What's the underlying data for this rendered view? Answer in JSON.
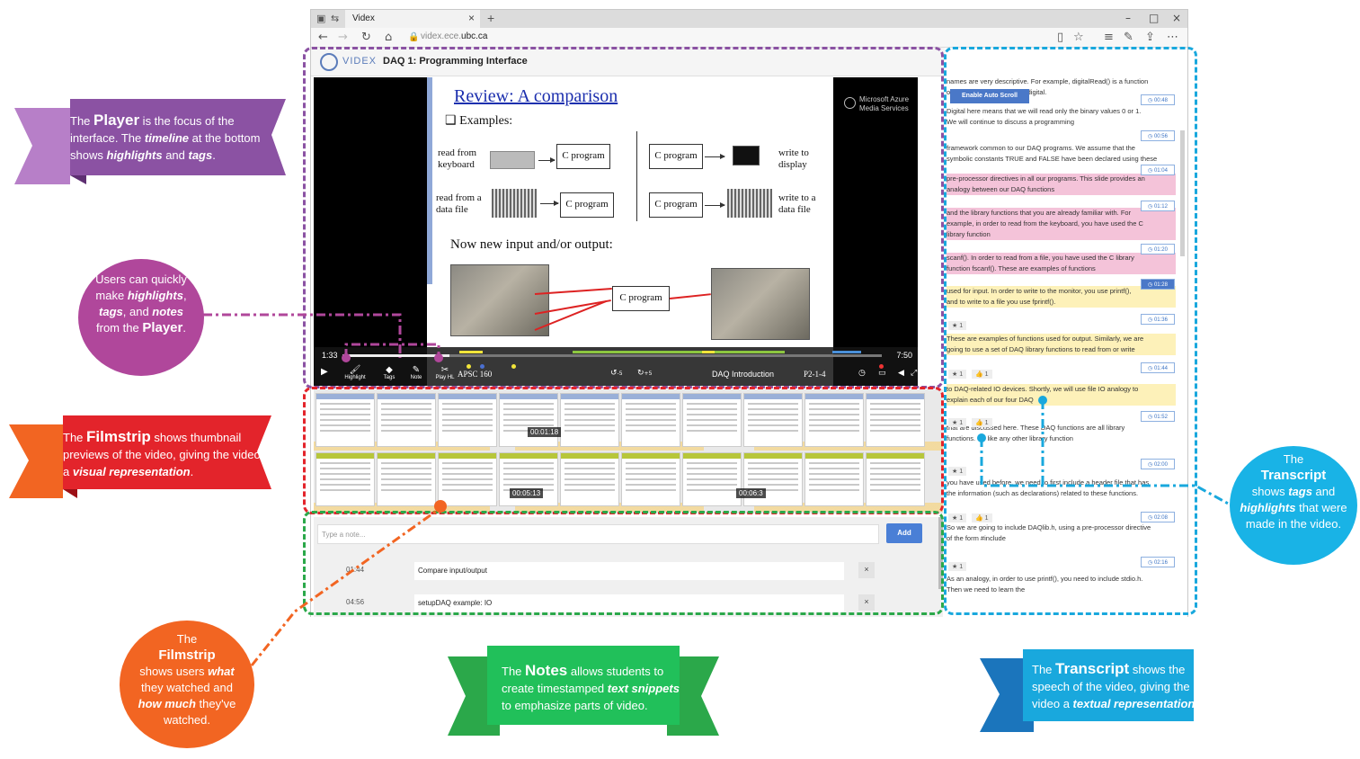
{
  "browser": {
    "tab_title": "Videx",
    "url_prefix": "videx.ece.",
    "url_domain": "ubc.ca"
  },
  "app": {
    "logo_text": "VIDEX",
    "lecture_title": "DAQ 1: Programming Interface"
  },
  "slide": {
    "title": "Review: A comparison",
    "subtitle": "Examples:",
    "read_keyboard": "read from keyboard",
    "read_datafile": "read from a data file",
    "c_program": "C program",
    "write_display": "write to display",
    "write_datafile": "write to a data file",
    "now_new": "Now new input and/or output:",
    "azure": "Microsoft Azure Media Services"
  },
  "player": {
    "current_time": "1:33",
    "total_time": "7:50",
    "progress_fraction": 0.198,
    "buttons": {
      "highlight": "Highlight",
      "tags": "Tags",
      "note": "Note",
      "play_hl": "Play HL"
    },
    "course": "APSC 160",
    "video_title": "DAQ Introduction",
    "video_code": "P2-1-4",
    "rewind_label": "-5",
    "forward_label": "+5"
  },
  "filmstrip": {
    "time_1": "00:01:18",
    "time_2": "00:05:13",
    "time_3": "00:06:3"
  },
  "notes": {
    "placeholder": "Type a note...",
    "add_label": "Add",
    "delete_label": "×",
    "items": [
      {
        "time": "01:44",
        "text": "Compare input/output"
      },
      {
        "time": "04:56",
        "text": "setupDAQ example: IO"
      }
    ]
  },
  "transcript": {
    "auto_scroll_label": "Enable Auto Scroll",
    "lines": [
      {
        "text": "names are very descriptive. For example, digitalRead() is a function",
        "hl": ""
      },
      {
        "text": "om an input device of type digital.",
        "hl": ""
      },
      {
        "text": "Digital here means that we will read only the binary values 0 or 1.",
        "hl": ""
      },
      {
        "text": "We will continue to discuss a programming",
        "hl": ""
      },
      {
        "text": "framework common to our DAQ programs. We assume that the",
        "hl": ""
      },
      {
        "text": "symbolic constants TRUE and FALSE have been declared using these",
        "hl": ""
      },
      {
        "text": "pre-processor directives in all our programs. This slide provides an",
        "hl": "pink"
      },
      {
        "text": "analogy between our DAQ functions",
        "hl": "pink"
      },
      {
        "text": "and the library functions that you are already familiar with. For",
        "hl": "pink"
      },
      {
        "text": "example, in order to read from the keyboard, you have used the C",
        "hl": "pink"
      },
      {
        "text": "library function",
        "hl": "pink"
      },
      {
        "text": "scanf(). In order to read from a file, you have used the C library",
        "hl": "pink"
      },
      {
        "text": "function fscanf(). These are examples of functions",
        "hl": "pink"
      },
      {
        "text": "used for input. In order to write to the monitor, you use printf(),",
        "hl": "yellow"
      },
      {
        "text": "and to write to a file you use fprintf().",
        "hl": "yellow"
      },
      {
        "text": "These are examples of functions used for output. Similarly, we are",
        "hl": "yellow"
      },
      {
        "text": "going to use a set of DAQ library functions to read from or write",
        "hl": "yellow"
      },
      {
        "text": "to DAQ-related IO devices. Shortly, we will use file IO analogy to",
        "hl": "yellow"
      },
      {
        "text": "explain each of our four DAQ",
        "hl": "yellow"
      },
      {
        "text": "that are discussed here. These DAQ functions are all library",
        "hl": ""
      },
      {
        "text": "functions. So like any other library function",
        "hl": ""
      },
      {
        "text": "you have used before, we need to first include a header file that has",
        "hl": ""
      },
      {
        "text": "the information (such as declarations) related to these functions.",
        "hl": ""
      },
      {
        "text": "So we are going to include DAQlib.h, using a pre-processor directive",
        "hl": ""
      },
      {
        "text": "of the form #include",
        "hl": ""
      },
      {
        "text": "As an analogy, in order to use printf(), you need to include stdio.h.",
        "hl": ""
      },
      {
        "text": "Then we need to learn the",
        "hl": ""
      }
    ],
    "timestamps": [
      "00:48",
      "00:56",
      "01:04",
      "01:12",
      "01:20",
      "01:28",
      "01:36",
      "01:44",
      "01:52",
      "02:00",
      "02:08",
      "02:16"
    ],
    "active_timestamp": "01:28",
    "tag_star": "★ 1",
    "tag_like": "👍 1"
  },
  "callouts": {
    "player": {
      "pre": "The ",
      "bold": "Player",
      "mid1": " is the focus of the interface. The ",
      "em1": "timeline",
      "mid2": " at the bottom shows ",
      "em2": "highlights",
      "mid3": " and ",
      "em3": "tags",
      "post": "."
    },
    "users": {
      "pre": "Users can quickly make ",
      "em1": "highlights",
      "mid1": ", ",
      "em2": "tags",
      "mid2": ", and ",
      "em3": "notes",
      "mid3": " from the ",
      "bold": "Player",
      "post": "."
    },
    "filmstrip_red": {
      "pre": "The ",
      "bold": "Filmstrip",
      "mid1": " shows thumbnail previews of the video, giving the video a ",
      "em1": "visual representation",
      "post": "."
    },
    "filmstrip_orange": {
      "pre": "The ",
      "bold": "Filmstrip",
      "mid1": " shows users ",
      "em1": "what",
      "mid2": " they watched and ",
      "em2": "how much",
      "post": " they've watched."
    },
    "notes": {
      "pre": "The ",
      "bold": "Notes",
      "mid1": " allows students to create timestamped ",
      "em1": "text snippets",
      "post": " to emphasize parts of video."
    },
    "transcript_circle": {
      "pre": "The ",
      "bold": "Transcript",
      "mid1": " shows ",
      "em1": "tags",
      "mid2": " and ",
      "em2": "highlights",
      "post": " that were made in the video."
    },
    "transcript_blue": {
      "pre": "The ",
      "bold": "Transcript",
      "mid1": " shows the speech of the video, giving the video a ",
      "em1": "textual representation",
      "post": "."
    }
  },
  "colors": {
    "purple": "#8b52a3",
    "magenta": "#b0479b",
    "red": "#e3242b",
    "orange": "#f26522",
    "green": "#2ba84a",
    "cyan": "#19a8dd",
    "blue": "#1b75bc"
  }
}
